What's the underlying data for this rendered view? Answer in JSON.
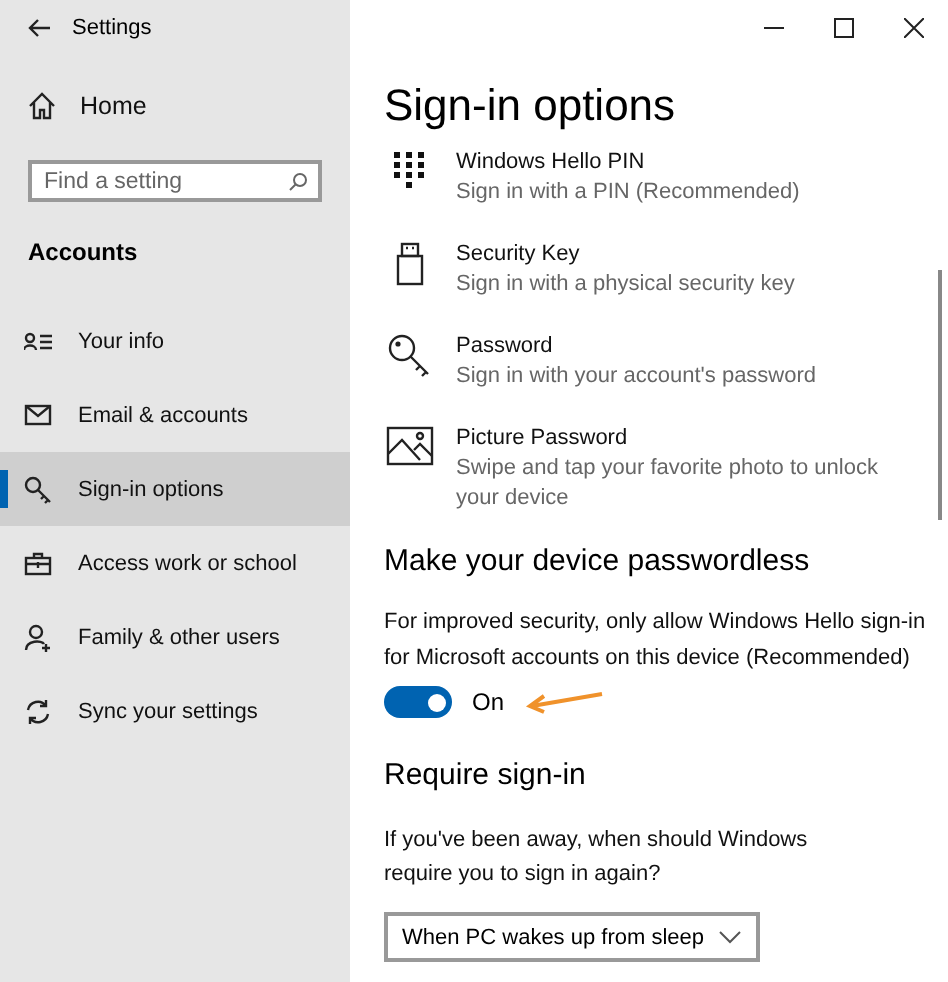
{
  "window": {
    "title": "Settings"
  },
  "sidebar": {
    "home": "Home",
    "search": {
      "placeholder": "Find a setting"
    },
    "section": "Accounts",
    "items": [
      {
        "label": "Your info",
        "selected": false
      },
      {
        "label": "Email & accounts",
        "selected": false
      },
      {
        "label": "Sign-in options",
        "selected": true
      },
      {
        "label": "Access work or school",
        "selected": false
      },
      {
        "label": "Family & other users",
        "selected": false
      },
      {
        "label": "Sync your settings",
        "selected": false
      }
    ]
  },
  "main": {
    "title": "Sign-in options",
    "options": [
      {
        "title": "Windows Hello PIN",
        "subtitle": "Sign in with a PIN (Recommended)"
      },
      {
        "title": "Security Key",
        "subtitle": "Sign in with a physical security key"
      },
      {
        "title": "Password",
        "subtitle": "Sign in with your account's password"
      },
      {
        "title": "Picture Password",
        "subtitle": "Swipe and tap your favorite photo to unlock your device"
      }
    ],
    "passwordless": {
      "heading": "Make your device passwordless",
      "description": "For improved security, only allow Windows Hello sign-in for Microsoft accounts on this device (Recommended)",
      "toggle": {
        "on": true,
        "label": "On"
      }
    },
    "require_signin": {
      "heading": "Require sign-in",
      "description": "If you've been away, when should Windows require you to sign in again?",
      "dropdown": {
        "value": "When PC wakes up from sleep"
      }
    }
  }
}
